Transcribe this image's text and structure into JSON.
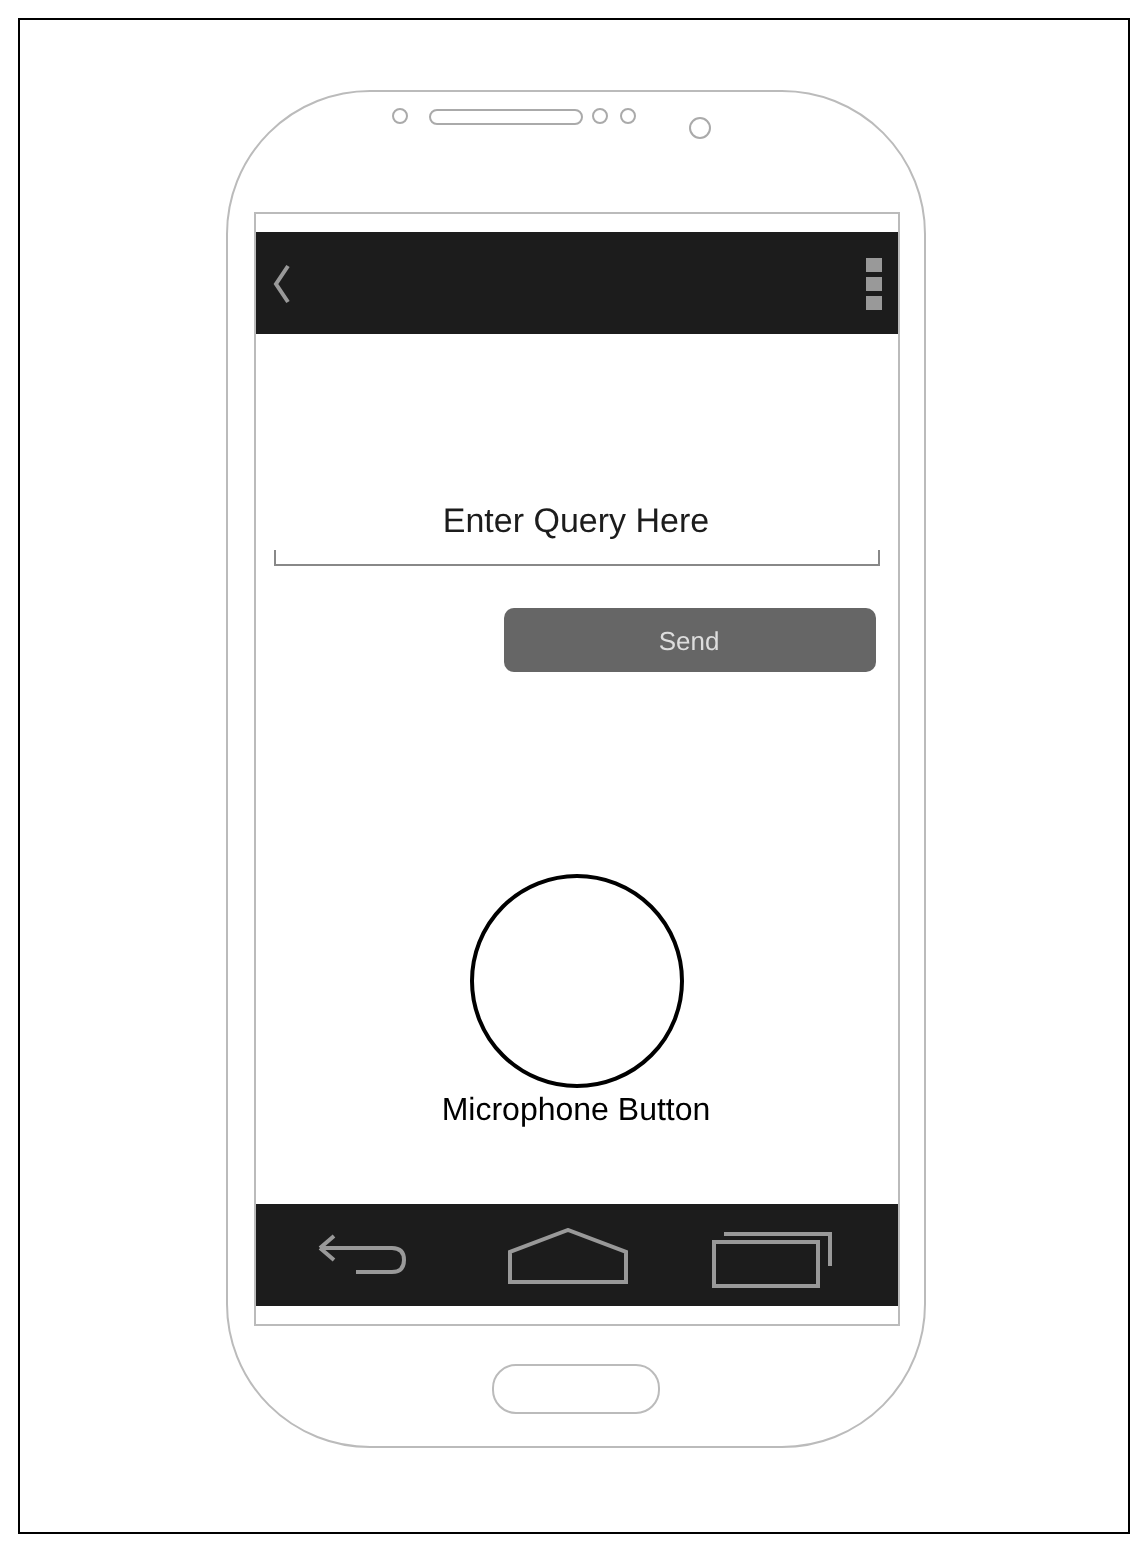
{
  "query_field": {
    "placeholder": "Enter Query Here"
  },
  "send_button": {
    "label": "Send"
  },
  "microphone": {
    "label": "Microphone Button"
  }
}
